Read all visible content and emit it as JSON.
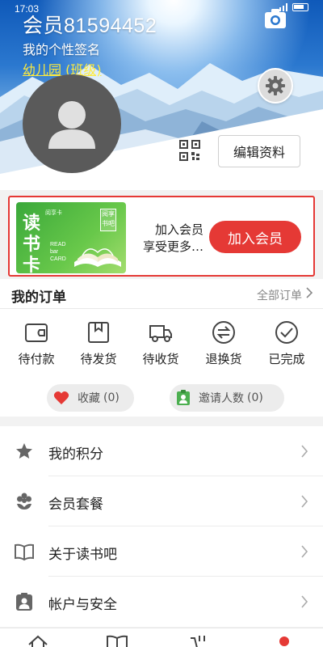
{
  "status_bar": {
    "time": "17:03"
  },
  "profile": {
    "member_id": "会员81594452",
    "signature": "我的个性签名",
    "class_name": "幼儿园 (班级)",
    "edit_label": "编辑资料"
  },
  "member_card": {
    "card_title": "读书卡",
    "card_tag": "阅享卡",
    "card_en": "READ\nbar\nCARD",
    "stamp": "阅享书吧",
    "line1": "加入会员",
    "line2": "享受更多…",
    "join_label": "加入会员"
  },
  "orders": {
    "title": "我的订单",
    "all_label": "全部订单",
    "items": [
      {
        "label": "待付款",
        "icon": "wallet-icon"
      },
      {
        "label": "待发货",
        "icon": "box-icon"
      },
      {
        "label": "待收货",
        "icon": "truck-icon"
      },
      {
        "label": "退换货",
        "icon": "exchange-icon"
      },
      {
        "label": "已完成",
        "icon": "check-circle-icon"
      }
    ],
    "favorites": {
      "label": "收藏",
      "count": "(0)"
    },
    "invites": {
      "label": "邀请人数",
      "count": "(0)"
    }
  },
  "menu": {
    "items": [
      {
        "label": "我的积分",
        "icon": "star-icon"
      },
      {
        "label": "会员套餐",
        "icon": "flower-icon"
      },
      {
        "label": "关于读书吧",
        "icon": "book-icon"
      },
      {
        "label": "帐户与安全",
        "icon": "account-lock-icon"
      }
    ]
  },
  "colors": {
    "accent": "#e53935",
    "link_yellow": "#ffeb3b",
    "icon_gray": "#666666"
  }
}
